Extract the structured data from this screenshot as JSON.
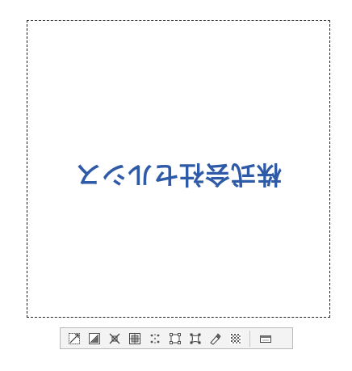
{
  "canvas": {
    "logo_text": "株式会社セルシス",
    "logo_color": "#2e5aa8"
  },
  "toolbar": {
    "tools": [
      {
        "name": "scale-up-down-icon"
      },
      {
        "name": "scale-keep-aspect-icon"
      },
      {
        "name": "rotate-icon"
      },
      {
        "name": "free-transform-icon"
      },
      {
        "name": "distort-icon"
      },
      {
        "name": "perspective-icon"
      },
      {
        "name": "mesh-transform-icon"
      },
      {
        "name": "flip-icon"
      },
      {
        "name": "pattern-icon"
      },
      {
        "name": "settings-panel-icon"
      }
    ]
  }
}
